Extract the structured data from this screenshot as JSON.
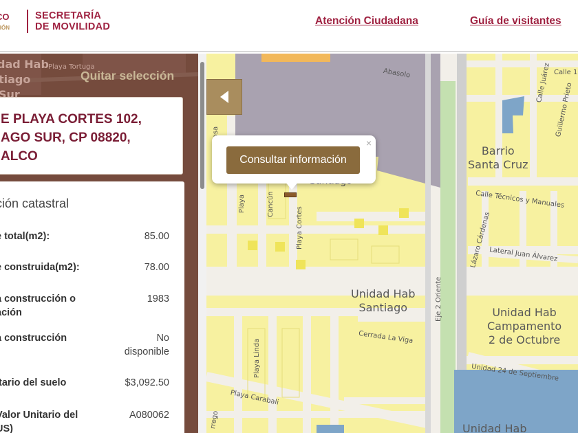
{
  "header": {
    "logo_left_line1": "CO",
    "logo_left_line2": "CIÓN",
    "org_line1": "SECRETARÍA",
    "org_line2": "DE MOVILIDAD",
    "nav": [
      "Atención Ciudadana",
      "Guía de visitantes"
    ]
  },
  "panel": {
    "clear_selection": "Quitar selección",
    "address": "E PLAYA CORTES 102,\nAGO SUR, CP 08820,\nALCO",
    "info_title": "ción catastral",
    "rows": [
      {
        "label": "e total(m2):",
        "value": "85.00"
      },
      {
        "label": "e construida(m2):",
        "value": "78.00"
      },
      {
        "label": "a construcción o\nación",
        "value": "1983"
      },
      {
        "label": "a construcción",
        "value": "No\ndisponible"
      },
      {
        "label": "itario del suelo",
        "value": "$3,092.50"
      },
      {
        "label": "Valor Unitario del\nUS)",
        "value": "A080062"
      }
    ]
  },
  "map": {
    "popup_button": "Consultar información",
    "popup_close": "×",
    "areas": [
      "Barrio\nSanta Cruz",
      "Unidad Hab\nSantiago",
      "Unidad Hab\nCampamento\n2 de Octubre",
      "Unidad Hab"
    ],
    "streets": [
      "Abasolo",
      "Calle Juárez",
      "Calle 1",
      "Guillermo Prieto",
      "Calle Técnicos y Manuales",
      "Lateral Juan Álvarez",
      "Lázaro Cárdenas",
      "Eje 2 Oriente",
      "Playa Cortes",
      "Playa",
      "Cancún",
      "Cerrada La Viga",
      "Playa Linda",
      "Playa Carabali",
      "Unidad 24 de Septiembre",
      "rrego",
      "Santiago",
      "Playa Rosa"
    ],
    "panel_bg_labels": [
      "dad Hab",
      "tiago",
      "Sur",
      "Playa Tortuga"
    ]
  }
}
